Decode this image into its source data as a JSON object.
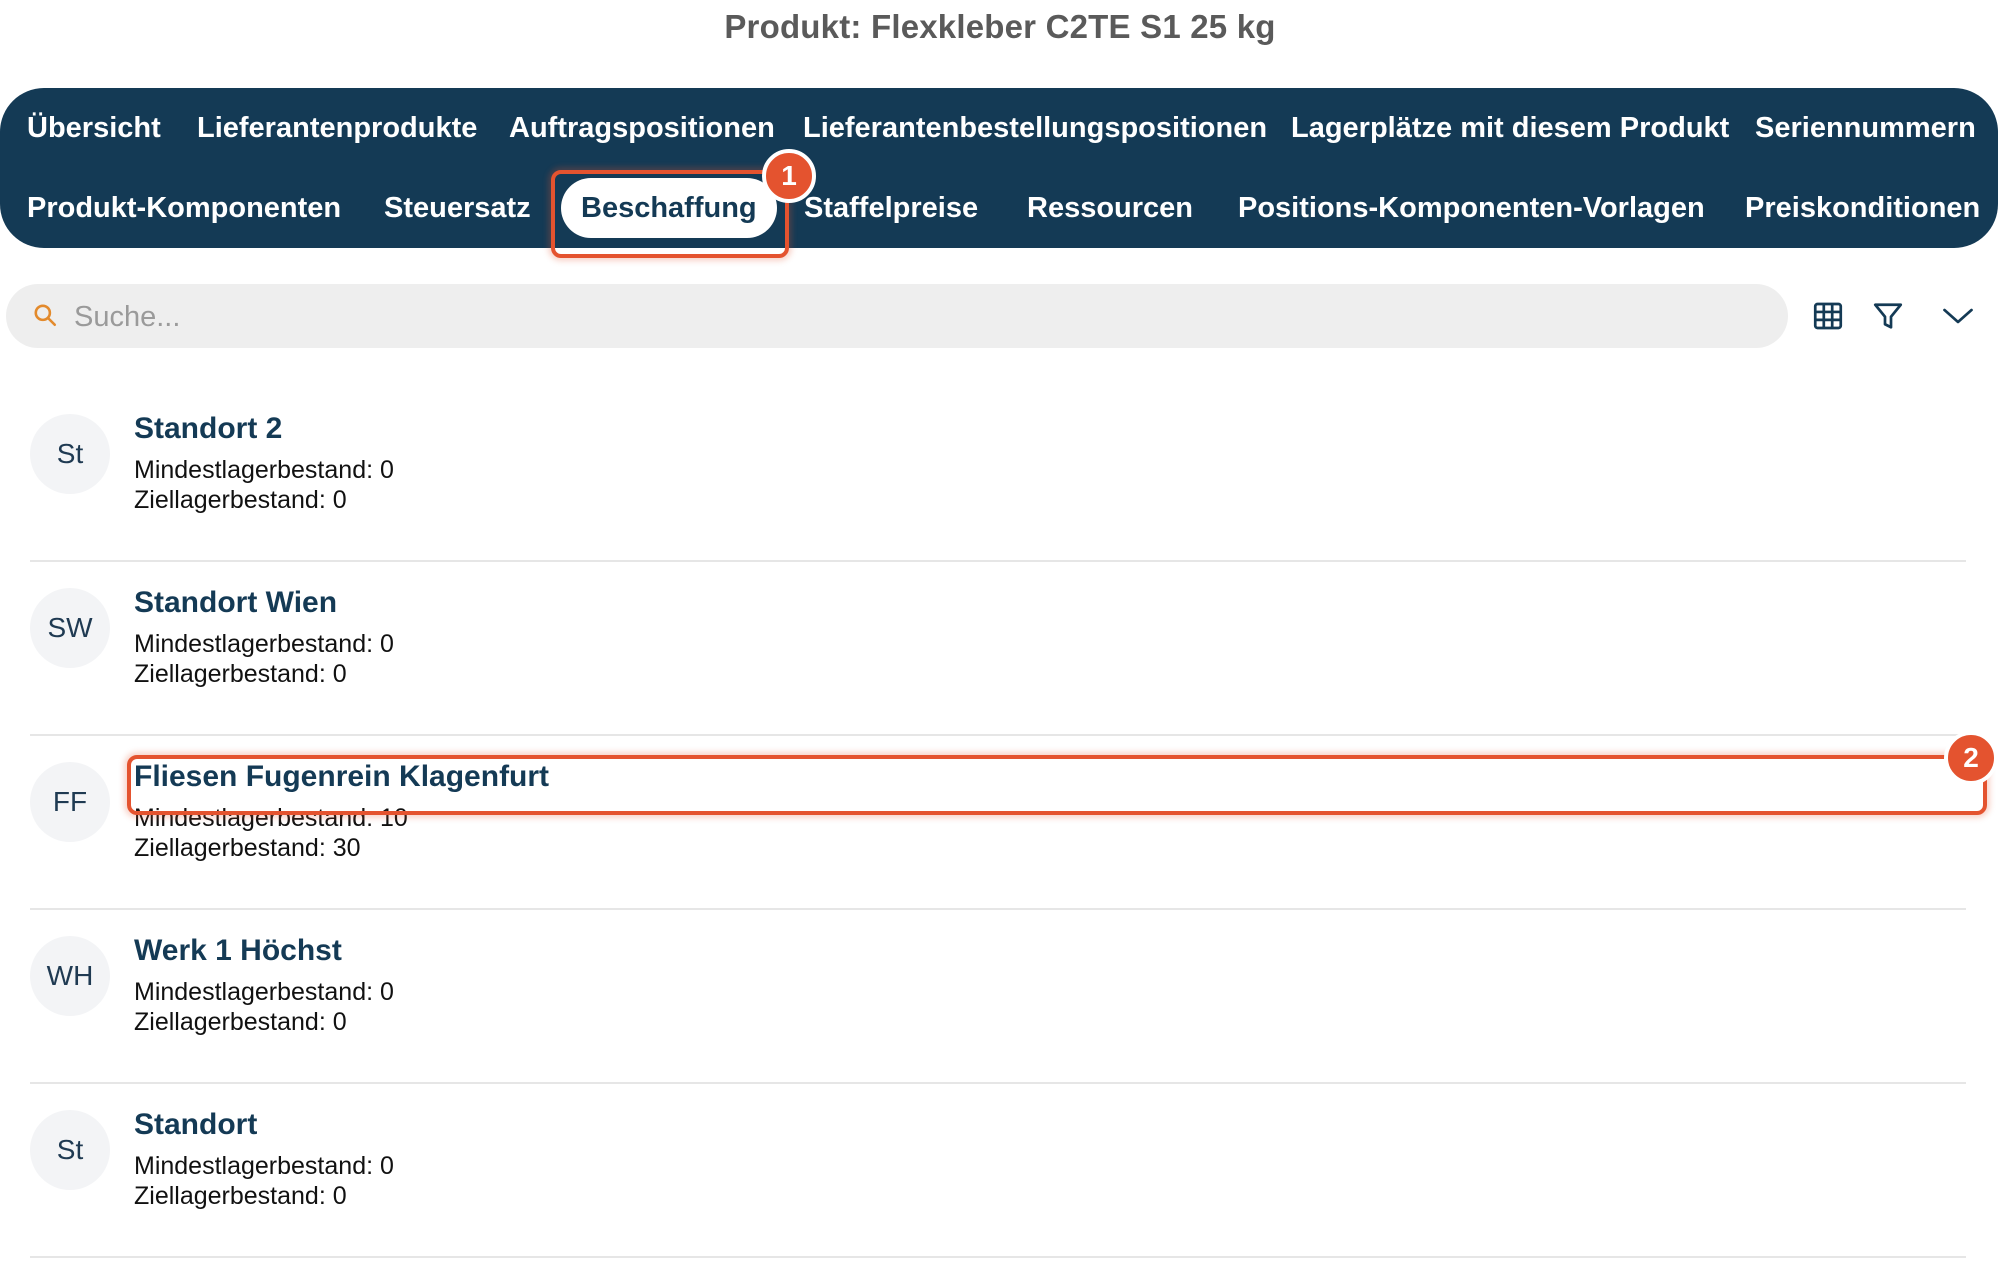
{
  "page_title": "Produkt: Flexkleber C2TE S1 25 kg",
  "tabs": {
    "row1": [
      "Übersicht",
      "Lieferantenprodukte",
      "Auftragspositionen",
      "Lieferantenbestellungspositionen",
      "Lagerplätze mit diesem Produkt",
      "Seriennummern"
    ],
    "row2": [
      "Produkt-Komponenten",
      "Steuersatz",
      "Beschaffung",
      "Staffelpreise",
      "Ressourcen",
      "Positions-Komponenten-Vorlagen",
      "Preiskonditionen"
    ],
    "active": "Beschaffung"
  },
  "annotations": {
    "badge1": "1",
    "badge2": "2"
  },
  "search": {
    "placeholder": "Suche..."
  },
  "toolbar_icons": [
    "table-icon",
    "filter-icon",
    "chevron-down-icon"
  ],
  "list": [
    {
      "initials": "St",
      "title": "Standort 2",
      "min_label": "Mindestlagerbestand: 0",
      "target_label": "Ziellagerbestand: 0"
    },
    {
      "initials": "SW",
      "title": "Standort Wien",
      "min_label": "Mindestlagerbestand: 0",
      "target_label": "Ziellagerbestand: 0"
    },
    {
      "initials": "FF",
      "title": "Fliesen Fugenrein Klagenfurt",
      "min_label": "Mindestlagerbestand: 10",
      "target_label": "Ziellagerbestand: 30"
    },
    {
      "initials": "WH",
      "title": "Werk 1 Höchst",
      "min_label": "Mindestlagerbestand: 0",
      "target_label": "Ziellagerbestand: 0"
    },
    {
      "initials": "St",
      "title": "Standort",
      "min_label": "Mindestlagerbestand: 0",
      "target_label": "Ziellagerbestand: 0"
    }
  ],
  "colors": {
    "tabbar_bg": "#143a55",
    "highlight": "#e4532f",
    "title_accent": "#143a55"
  }
}
